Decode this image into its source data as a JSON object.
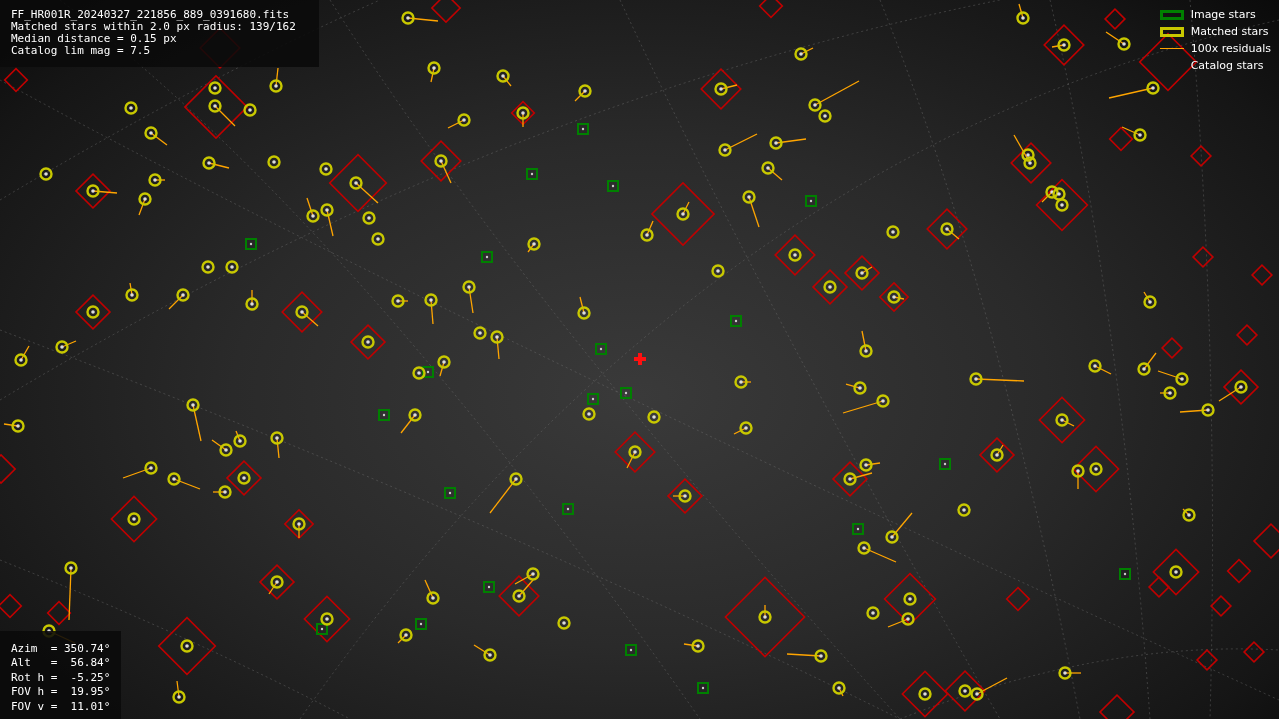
{
  "info_lines": [
    "FF_HR001R_20240327_221856_889_0391680.fits",
    "Matched stars within 2.0 px radius: 139/162",
    "Median distance = 0.15 px",
    "Catalog lim mag = 7.5"
  ],
  "pointing_lines": [
    "Azim  = 350.74°",
    "Alt   =  56.84°",
    "Rot h =  -5.25°",
    "FOV h =  19.95°",
    "FOV v =  11.01°"
  ],
  "legend": [
    {
      "kind": "box",
      "color": "#008000",
      "label": "Image stars"
    },
    {
      "kind": "box",
      "color": "#c8c800",
      "label": "Matched stars"
    },
    {
      "kind": "line",
      "color": "#ffa500",
      "label": "100x residuals"
    },
    {
      "kind": "none",
      "label": "Catalog stars"
    }
  ]
}
